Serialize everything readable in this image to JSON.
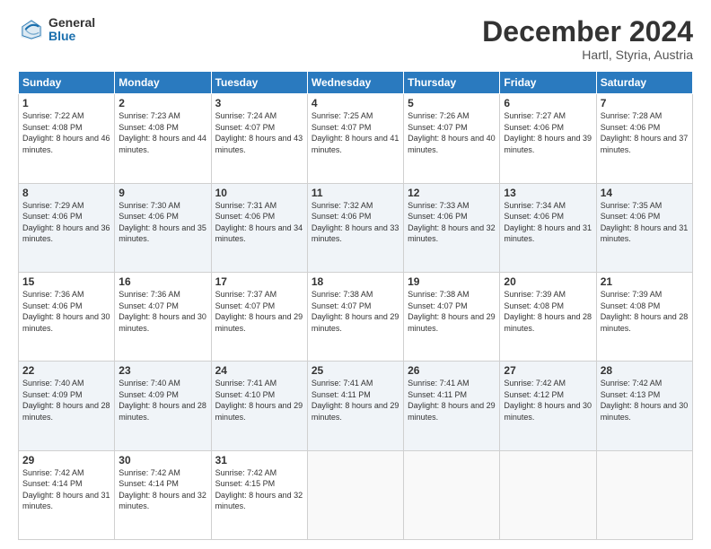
{
  "logo": {
    "general": "General",
    "blue": "Blue"
  },
  "header": {
    "month": "December 2024",
    "location": "Hartl, Styria, Austria"
  },
  "weekdays": [
    "Sunday",
    "Monday",
    "Tuesday",
    "Wednesday",
    "Thursday",
    "Friday",
    "Saturday"
  ],
  "weeks": [
    [
      {
        "day": "1",
        "sunrise": "7:22 AM",
        "sunset": "4:08 PM",
        "daylight": "8 hours and 46 minutes."
      },
      {
        "day": "2",
        "sunrise": "7:23 AM",
        "sunset": "4:08 PM",
        "daylight": "8 hours and 44 minutes."
      },
      {
        "day": "3",
        "sunrise": "7:24 AM",
        "sunset": "4:07 PM",
        "daylight": "8 hours and 43 minutes."
      },
      {
        "day": "4",
        "sunrise": "7:25 AM",
        "sunset": "4:07 PM",
        "daylight": "8 hours and 41 minutes."
      },
      {
        "day": "5",
        "sunrise": "7:26 AM",
        "sunset": "4:07 PM",
        "daylight": "8 hours and 40 minutes."
      },
      {
        "day": "6",
        "sunrise": "7:27 AM",
        "sunset": "4:06 PM",
        "daylight": "8 hours and 39 minutes."
      },
      {
        "day": "7",
        "sunrise": "7:28 AM",
        "sunset": "4:06 PM",
        "daylight": "8 hours and 37 minutes."
      }
    ],
    [
      {
        "day": "8",
        "sunrise": "7:29 AM",
        "sunset": "4:06 PM",
        "daylight": "8 hours and 36 minutes."
      },
      {
        "day": "9",
        "sunrise": "7:30 AM",
        "sunset": "4:06 PM",
        "daylight": "8 hours and 35 minutes."
      },
      {
        "day": "10",
        "sunrise": "7:31 AM",
        "sunset": "4:06 PM",
        "daylight": "8 hours and 34 minutes."
      },
      {
        "day": "11",
        "sunrise": "7:32 AM",
        "sunset": "4:06 PM",
        "daylight": "8 hours and 33 minutes."
      },
      {
        "day": "12",
        "sunrise": "7:33 AM",
        "sunset": "4:06 PM",
        "daylight": "8 hours and 32 minutes."
      },
      {
        "day": "13",
        "sunrise": "7:34 AM",
        "sunset": "4:06 PM",
        "daylight": "8 hours and 31 minutes."
      },
      {
        "day": "14",
        "sunrise": "7:35 AM",
        "sunset": "4:06 PM",
        "daylight": "8 hours and 31 minutes."
      }
    ],
    [
      {
        "day": "15",
        "sunrise": "7:36 AM",
        "sunset": "4:06 PM",
        "daylight": "8 hours and 30 minutes."
      },
      {
        "day": "16",
        "sunrise": "7:36 AM",
        "sunset": "4:07 PM",
        "daylight": "8 hours and 30 minutes."
      },
      {
        "day": "17",
        "sunrise": "7:37 AM",
        "sunset": "4:07 PM",
        "daylight": "8 hours and 29 minutes."
      },
      {
        "day": "18",
        "sunrise": "7:38 AM",
        "sunset": "4:07 PM",
        "daylight": "8 hours and 29 minutes."
      },
      {
        "day": "19",
        "sunrise": "7:38 AM",
        "sunset": "4:07 PM",
        "daylight": "8 hours and 29 minutes."
      },
      {
        "day": "20",
        "sunrise": "7:39 AM",
        "sunset": "4:08 PM",
        "daylight": "8 hours and 28 minutes."
      },
      {
        "day": "21",
        "sunrise": "7:39 AM",
        "sunset": "4:08 PM",
        "daylight": "8 hours and 28 minutes."
      }
    ],
    [
      {
        "day": "22",
        "sunrise": "7:40 AM",
        "sunset": "4:09 PM",
        "daylight": "8 hours and 28 minutes."
      },
      {
        "day": "23",
        "sunrise": "7:40 AM",
        "sunset": "4:09 PM",
        "daylight": "8 hours and 28 minutes."
      },
      {
        "day": "24",
        "sunrise": "7:41 AM",
        "sunset": "4:10 PM",
        "daylight": "8 hours and 29 minutes."
      },
      {
        "day": "25",
        "sunrise": "7:41 AM",
        "sunset": "4:11 PM",
        "daylight": "8 hours and 29 minutes."
      },
      {
        "day": "26",
        "sunrise": "7:41 AM",
        "sunset": "4:11 PM",
        "daylight": "8 hours and 29 minutes."
      },
      {
        "day": "27",
        "sunrise": "7:42 AM",
        "sunset": "4:12 PM",
        "daylight": "8 hours and 30 minutes."
      },
      {
        "day": "28",
        "sunrise": "7:42 AM",
        "sunset": "4:13 PM",
        "daylight": "8 hours and 30 minutes."
      }
    ],
    [
      {
        "day": "29",
        "sunrise": "7:42 AM",
        "sunset": "4:14 PM",
        "daylight": "8 hours and 31 minutes."
      },
      {
        "day": "30",
        "sunrise": "7:42 AM",
        "sunset": "4:14 PM",
        "daylight": "8 hours and 32 minutes."
      },
      {
        "day": "31",
        "sunrise": "7:42 AM",
        "sunset": "4:15 PM",
        "daylight": "8 hours and 32 minutes."
      },
      null,
      null,
      null,
      null
    ]
  ],
  "labels": {
    "sunrise": "Sunrise:",
    "sunset": "Sunset:",
    "daylight": "Daylight:"
  }
}
